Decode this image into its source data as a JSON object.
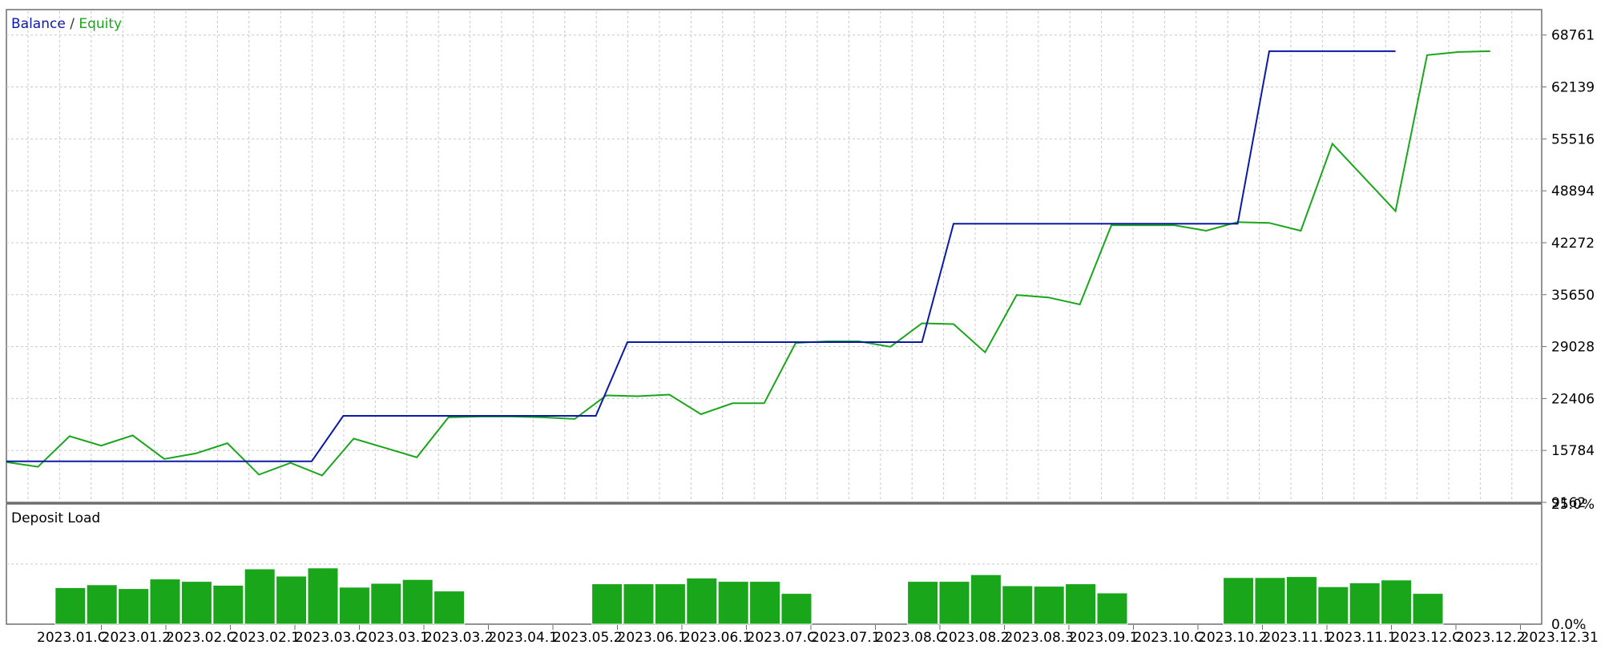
{
  "chart_data": [
    {
      "type": "line",
      "title_parts": [
        {
          "text": "Balance",
          "color": "#0b1aa6"
        },
        {
          "text": " / ",
          "color": "#333333"
        },
        {
          "text": "Equity",
          "color": "#1aa61a"
        }
      ],
      "ylim": [
        9162,
        72000
      ],
      "y_ticks": [
        "68761",
        "62139",
        "55516",
        "48894",
        "42272",
        "35650",
        "29028",
        "22406",
        "15784",
        "9162"
      ],
      "grid": true,
      "series": [
        {
          "name": "Balance",
          "color": "#0b1aa6",
          "points": [
            [
              0,
              14400
            ],
            [
              9.67,
              14400
            ],
            [
              10.67,
              20200
            ],
            [
              18.67,
              20200
            ],
            [
              19.67,
              29600
            ],
            [
              29.0,
              29600
            ],
            [
              30.0,
              44700
            ],
            [
              39.0,
              44700
            ],
            [
              40.0,
              66700
            ],
            [
              44.0,
              66700
            ]
          ]
        },
        {
          "name": "Equity",
          "color": "#1aa61a",
          "points": [
            [
              0,
              14300
            ],
            [
              1,
              13700
            ],
            [
              2,
              17600
            ],
            [
              3,
              16400
            ],
            [
              4,
              17700
            ],
            [
              5,
              14700
            ],
            [
              6,
              15400
            ],
            [
              7,
              16700
            ],
            [
              8,
              12700
            ],
            [
              9,
              14200
            ],
            [
              10,
              12600
            ],
            [
              11,
              17300
            ],
            [
              12,
              16100
            ],
            [
              13,
              14900
            ],
            [
              14,
              20000
            ],
            [
              15,
              20100
            ],
            [
              16,
              20100
            ],
            [
              17,
              20000
            ],
            [
              18,
              19800
            ],
            [
              19,
              22800
            ],
            [
              20,
              22700
            ],
            [
              21,
              22900
            ],
            [
              22,
              20400
            ],
            [
              23,
              21800
            ],
            [
              24,
              21800
            ],
            [
              25,
              29500
            ],
            [
              26,
              29700
            ],
            [
              27,
              29700
            ],
            [
              28,
              29000
            ],
            [
              29,
              32000
            ],
            [
              30,
              31900
            ],
            [
              31,
              28300
            ],
            [
              32,
              35600
            ],
            [
              33,
              35300
            ],
            [
              34,
              34400
            ],
            [
              35,
              44500
            ],
            [
              36,
              44500
            ],
            [
              37,
              44500
            ],
            [
              38,
              43800
            ],
            [
              39,
              44900
            ],
            [
              40,
              44800
            ],
            [
              41,
              43800
            ],
            [
              42,
              54900
            ],
            [
              43,
              50600
            ],
            [
              44,
              46300
            ],
            [
              45,
              66200
            ],
            [
              46,
              66600
            ],
            [
              47,
              66700
            ]
          ]
        }
      ]
    },
    {
      "type": "bar",
      "title": "Deposit Load",
      "ylim": [
        0,
        25
      ],
      "y_ticks": [
        "25.0%",
        "0.0%"
      ],
      "color": "#1aa61a",
      "bars": [
        [
          2,
          7.6
        ],
        [
          3,
          8.2
        ],
        [
          4,
          7.4
        ],
        [
          5,
          9.4
        ],
        [
          6,
          8.9
        ],
        [
          7,
          8.1
        ],
        [
          8,
          11.5
        ],
        [
          9,
          10.0
        ],
        [
          10,
          11.7
        ],
        [
          11,
          7.7
        ],
        [
          12,
          8.5
        ],
        [
          13,
          9.3
        ],
        [
          14,
          6.9
        ],
        [
          19,
          8.4
        ],
        [
          20,
          8.4
        ],
        [
          21,
          8.4
        ],
        [
          22,
          9.6
        ],
        [
          23,
          8.9
        ],
        [
          24,
          8.9
        ],
        [
          25,
          6.4
        ],
        [
          29,
          8.9
        ],
        [
          30,
          8.9
        ],
        [
          31,
          10.3
        ],
        [
          32,
          8.0
        ],
        [
          33,
          7.9
        ],
        [
          34,
          8.4
        ],
        [
          35,
          6.5
        ],
        [
          39,
          9.7
        ],
        [
          40,
          9.7
        ],
        [
          41,
          9.9
        ],
        [
          42,
          7.8
        ],
        [
          43,
          8.6
        ],
        [
          44,
          9.2
        ],
        [
          45,
          6.4
        ]
      ]
    }
  ],
  "x_tick_labels": [
    "2023.01.C",
    "2023.01.2",
    "2023.02.C",
    "2023.02.1",
    "2023.03.C",
    "2023.03.1",
    "2023.03.2",
    "2023.04.1",
    "2023.05.2",
    "2023.06.1",
    "2023.06.1",
    "2023.07.C",
    "2023.07.1",
    "2023.08.C",
    "2023.08.2",
    "2023.08.3",
    "2023.09.1",
    "2023.10.C",
    "2023.10.2",
    "2023.11.1",
    "2023.11.1",
    "2023.12.C",
    "2023.12.2",
    "2023.12.31"
  ]
}
